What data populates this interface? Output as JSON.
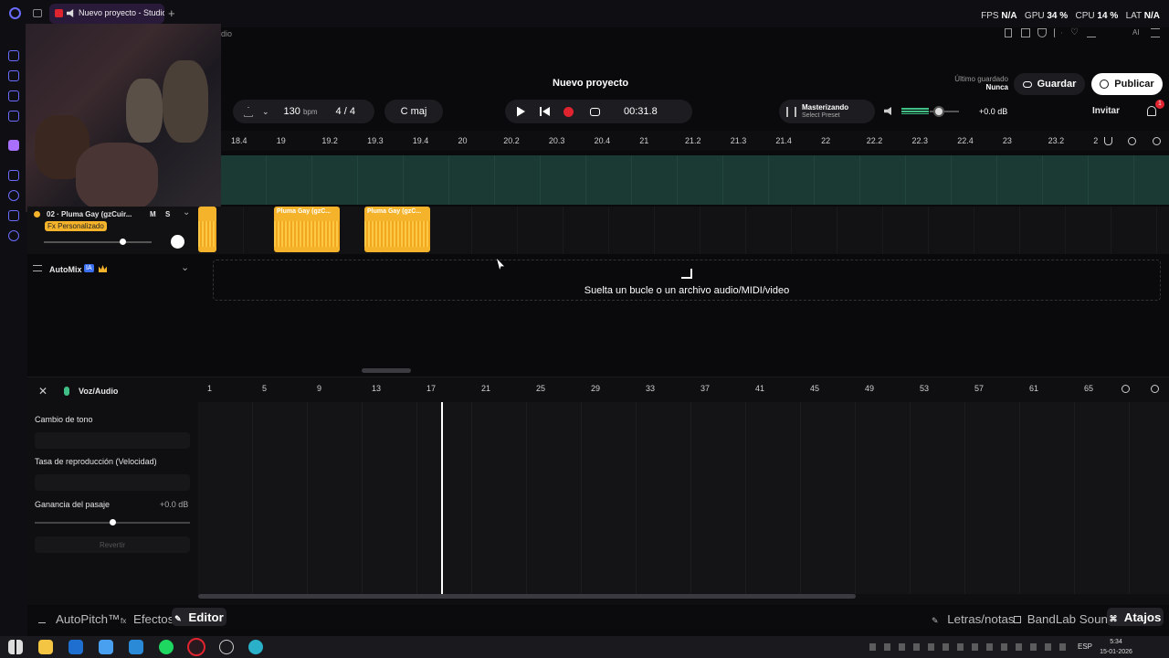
{
  "browser": {
    "tab_title": "Nuevo proyecto - Studio",
    "sub_caption": "dio",
    "stats": {
      "fps_label": "FPS",
      "fps_value": "N/A",
      "gpu_label": "GPU",
      "gpu_value": "34 %",
      "cpu_label": "CPU",
      "cpu_value": "14 %",
      "lat_label": "LAT",
      "lat_value": "N/A"
    }
  },
  "header": {
    "project_title": "Nuevo proyecto",
    "last_saved_label": "Último guardado",
    "last_saved_value": "Nunca",
    "save_label": "Guardar",
    "publish_label": "Publicar"
  },
  "transport": {
    "tempo": "130",
    "tempo_unit": "bpm",
    "time_sig": "4 / 4",
    "key": "C maj",
    "time": "00:31.8",
    "mastering_title": "Masterizando",
    "mastering_preset": "Select Preset",
    "volume_db": "+0.0 dB",
    "invite_label": "Invitar",
    "notif_count": "1"
  },
  "ruler": [
    "18.4",
    "19",
    "19.2",
    "19.3",
    "19.4",
    "20",
    "20.2",
    "20.3",
    "20.4",
    "21",
    "21.2",
    "21.3",
    "21.4",
    "22",
    "22.2",
    "22.3",
    "22.4",
    "23",
    "23.2",
    "2"
  ],
  "track": {
    "name": "02 · Pluma Gay (gzCuir...",
    "fx_badge": "Fx Personalizado",
    "mute": "M",
    "solo": "S",
    "clips": [
      "Pluma Gay (gzC...",
      "Pluma Gay (gzC..."
    ]
  },
  "automix": {
    "label": "AutoMix",
    "badge": "IA"
  },
  "dropzone": {
    "text": "Suelta un bucle o un archivo audio/MIDI/video"
  },
  "editor": {
    "title": "Voz/Audio",
    "ruler": [
      "1",
      "5",
      "9",
      "13",
      "17",
      "21",
      "25",
      "29",
      "33",
      "37",
      "41",
      "45",
      "49",
      "53",
      "57",
      "61",
      "65"
    ],
    "pitch_label": "Cambio de tono",
    "rate_label": "Tasa de reproducción (Velocidad)",
    "gain_label": "Ganancia del pasaje",
    "gain_value": "+0.0 dB",
    "revert_label": "Revertir"
  },
  "bottom_tabs": {
    "autopitch": "AutoPitch™",
    "effects": "Efectos",
    "editor": "Editor",
    "lyrics": "Letras/notas",
    "sounds": "BandLab Sounds",
    "shortcuts": "Atajos"
  },
  "taskbar": {
    "lang": "ESP",
    "time": "5:34",
    "date": "15-01-2026"
  },
  "colors": {
    "accent_record": "#e0242f",
    "track_lane": "#1a3a33",
    "clip": "#f4b32a",
    "fx_badge": "#f4b32a"
  }
}
